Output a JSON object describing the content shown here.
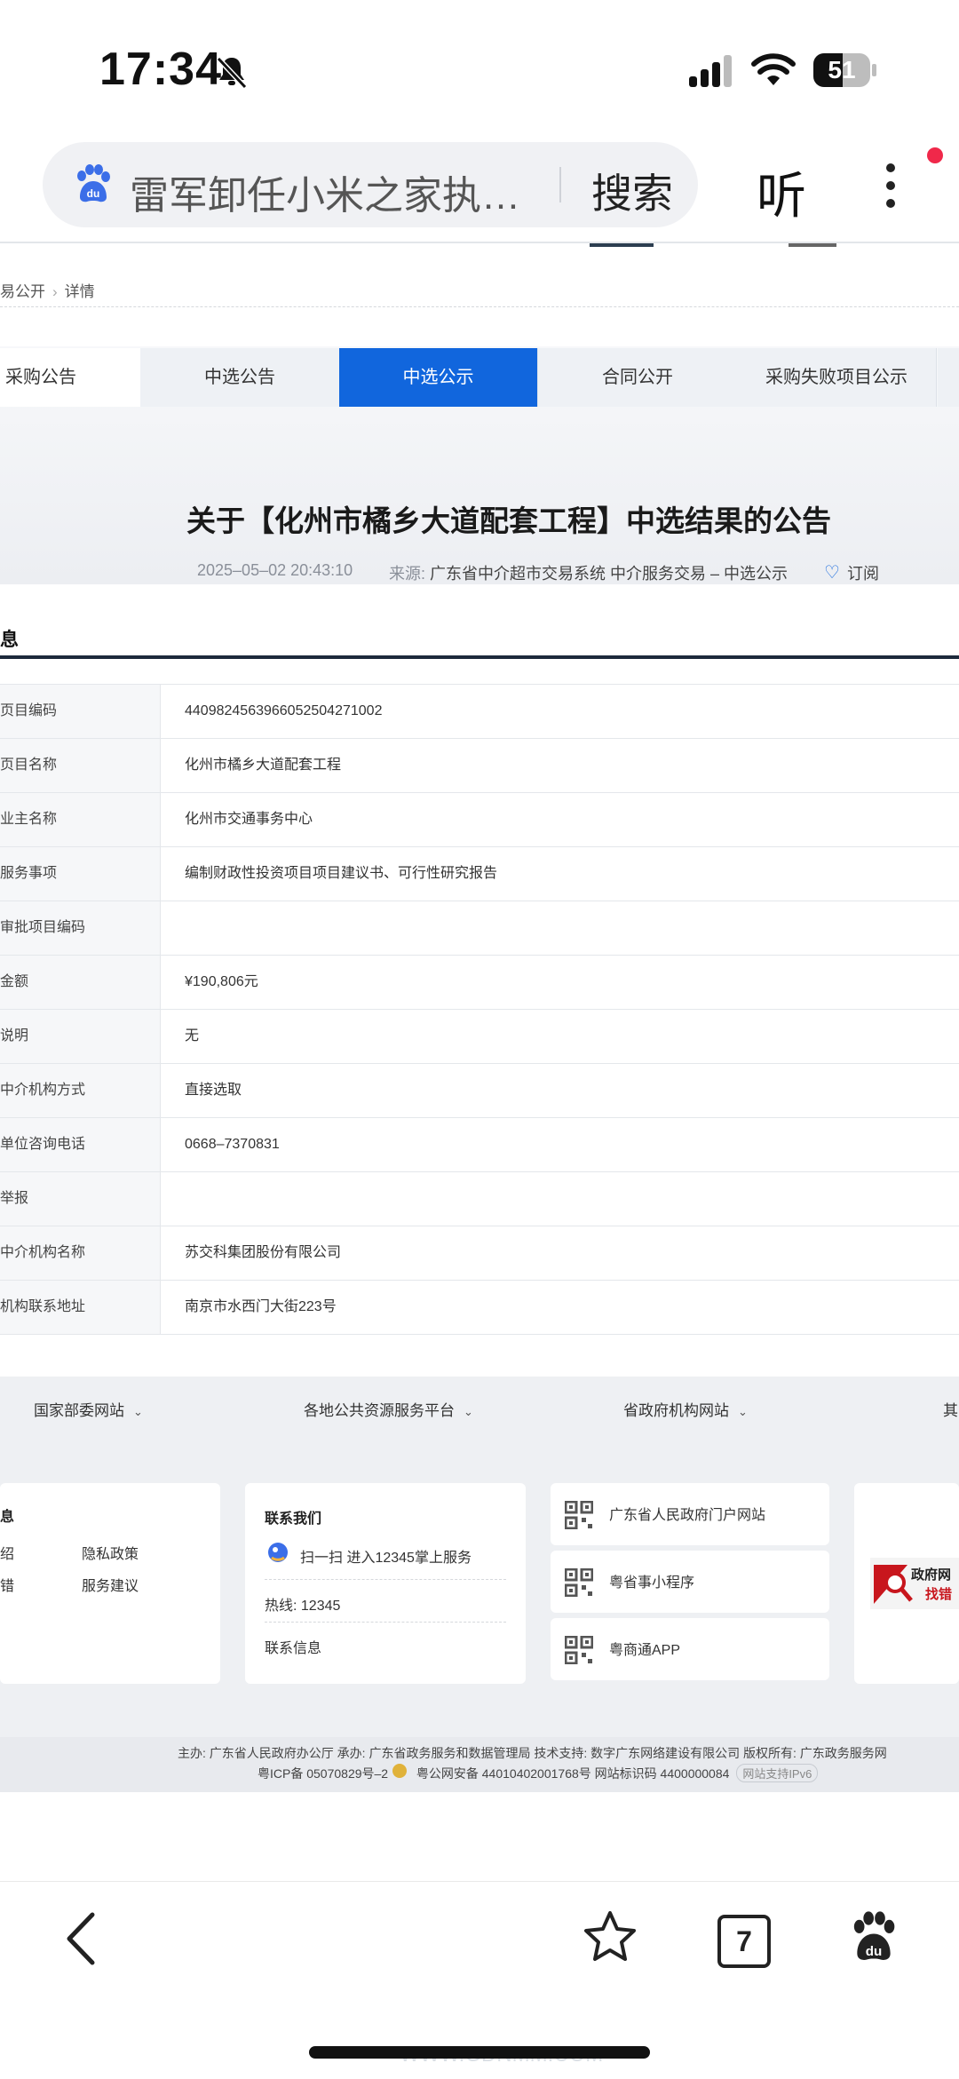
{
  "status_bar": {
    "time": "17:34",
    "battery": "51",
    "battery_level": 0.51
  },
  "browser": {
    "search_text": "雷军卸任小米之家执…",
    "search_button": "搜索",
    "listen_button": "听"
  },
  "breadcrumb": {
    "parent": "易公开",
    "current": "详情"
  },
  "tabs": [
    {
      "label": "采购公告"
    },
    {
      "label": "中选公告"
    },
    {
      "label": "中选公示"
    },
    {
      "label": "合同公开"
    },
    {
      "label": "采购失败项目公示"
    }
  ],
  "notice": {
    "title": "关于【化州市橘乡大道配套工程】中选结果的公告",
    "datetime": "2025–05–02 20:43:10",
    "source_label": "来源:",
    "source": "广东省中介超市交易系统 中介服务交易 – 中选公示",
    "subscribe": "订阅"
  },
  "info": {
    "heading": "息",
    "rows": [
      {
        "key": "页目编码",
        "value": "440982456396605250427100​2"
      },
      {
        "key": "页目名称",
        "value": "化州市橘乡大道配套工程"
      },
      {
        "key": "业主名称",
        "value": "化州市交通事务中心"
      },
      {
        "key": "服务事项",
        "value": "编制财政性投资项目项目建议书、可行性研究报告"
      },
      {
        "key": "审批项目编码",
        "value": ""
      },
      {
        "key": "金额",
        "value": "¥190,806元"
      },
      {
        "key": "说明",
        "value": "无"
      },
      {
        "key": "中介机构方式",
        "value": "直接选取"
      },
      {
        "key": "单位咨询电话",
        "value": "0668–7370831"
      },
      {
        "key": "举报",
        "value": ""
      },
      {
        "key": "中介机构名称",
        "value": "苏交科集团股份有限公司"
      },
      {
        "key": "机构联系地址",
        "value": "南京市水西门大街223号"
      }
    ]
  },
  "footer": {
    "nav": [
      "国家部委网站",
      "各地公共资源服务平台",
      "省政府机构网站",
      "其"
    ],
    "left_card": {
      "title": "息",
      "links": [
        "绍",
        "隐私政策",
        "错",
        "服务建议"
      ]
    },
    "contact": {
      "title": "联系我们",
      "scan": "扫一扫 进入12345掌上服务",
      "hotline": "热线: 12345",
      "info": "联系信息"
    },
    "links": [
      "广东省人民政府门户网站",
      "粤省事小程序",
      "粤商通APP"
    ],
    "gov_badge": {
      "line1": "政府网",
      "line2": "找错"
    },
    "bottom_line1": "主办: 广东省人民政府办公厅 承办: 广东省政务服务和数据管理局 技术支持: 数字广东网络建设有限公司 版权所有: 广东政务服务网",
    "bottom_line2": "粤ICP备 05070829号–2",
    "bottom_line2b": "粤公网安备 44010402001768号 网站标识码 4400000084",
    "ipv6": "网站支持IPv6"
  },
  "toolbar": {
    "tab_count": "7"
  },
  "watermark": "WWW.GDNMM.COM",
  "colors": {
    "accent": "#1166dd",
    "dark_line": "#1d2a3c",
    "notify": "#f0284a"
  }
}
